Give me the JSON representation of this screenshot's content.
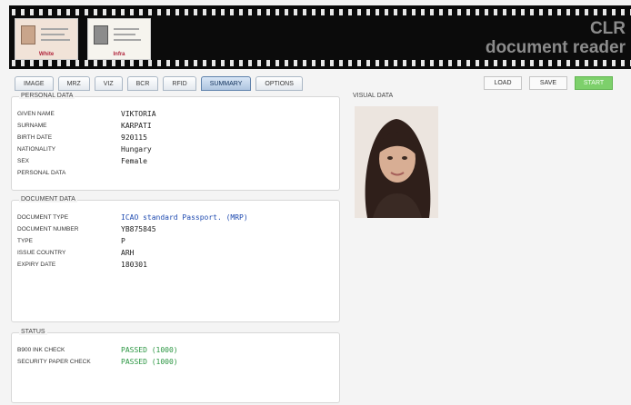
{
  "header": {
    "brand_line1": "CLR",
    "brand_line2": "document reader",
    "thumbnails": [
      {
        "caption": "White"
      },
      {
        "caption": "Infra"
      }
    ]
  },
  "tabs": [
    "IMAGE",
    "MRZ",
    "VIZ",
    "BCR",
    "RFID",
    "SUMMARY",
    "OPTIONS"
  ],
  "active_tab": "SUMMARY",
  "buttons": {
    "load": "LOAD",
    "save": "SAVE",
    "start": "START"
  },
  "personal_data": {
    "title": "PERSONAL DATA",
    "rows": [
      {
        "label": "GIVEN NAME",
        "value": "VIKTORIA"
      },
      {
        "label": "SURNAME",
        "value": "KARPATI"
      },
      {
        "label": "BIRTH DATE",
        "value": "920115"
      },
      {
        "label": "NATIONALITY",
        "value": "Hungary"
      },
      {
        "label": "SEX",
        "value": "Female"
      },
      {
        "label": "PERSONAL DATA",
        "value": ""
      }
    ]
  },
  "document_data": {
    "title": "DOCUMENT DATA",
    "rows": [
      {
        "label": "DOCUMENT TYPE",
        "value": "ICAO standard Passport. (MRP)"
      },
      {
        "label": "DOCUMENT NUMBER",
        "value": "YB875845"
      },
      {
        "label": "TYPE",
        "value": "P"
      },
      {
        "label": "ISSUE COUNTRY",
        "value": "ARH"
      },
      {
        "label": "EXPIRY DATE",
        "value": "180301"
      }
    ]
  },
  "status": {
    "title": "STATUS",
    "rows": [
      {
        "label": "B900 INK CHECK",
        "value": "PASSED (1000)"
      },
      {
        "label": "SECURITY PAPER CHECK",
        "value": "PASSED (1000)"
      }
    ]
  },
  "visual_data": {
    "title": "VISUAL DATA"
  },
  "colors": {
    "active_tab": "#aec5e0",
    "start_button": "#7dd06b",
    "passed": "#2b9642",
    "document_type": "#1e4ab0"
  },
  "icons": [
    "passport-white-thumbnail",
    "passport-infra-thumbnail",
    "face-portrait"
  ]
}
